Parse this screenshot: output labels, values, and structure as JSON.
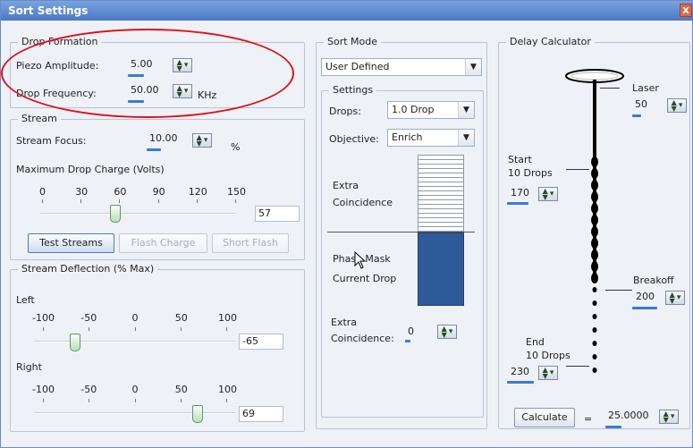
{
  "window": {
    "title": "Sort Settings",
    "close_label": "X"
  },
  "drop_formation": {
    "legend": "Drop Formation",
    "piezo_label": "Piezo Amplitude:",
    "piezo_value": "5.00",
    "freq_label": "Drop Frequency:",
    "freq_value": "50.00",
    "freq_unit": "KHz"
  },
  "stream": {
    "legend": "Stream",
    "focus_label": "Stream Focus:",
    "focus_value": "10.00",
    "focus_unit": "%",
    "charge_label": "Maximum Drop Charge (Volts)",
    "ticks": [
      "0",
      "30",
      "60",
      "90",
      "120",
      "150"
    ],
    "charge_slider_value": 57,
    "charge_value": "57",
    "test_button": "Test Streams",
    "flash_button": "Flash Charge",
    "short_button": "Short Flash"
  },
  "deflection": {
    "legend": "Stream Deflection (% Max)",
    "left_label": "Left",
    "left_ticks": [
      "-100",
      "-50",
      "0",
      "50",
      "100"
    ],
    "left_slider_value": -65,
    "left_value": "-65",
    "right_label": "Right",
    "right_ticks": [
      "-100",
      "-50",
      "0",
      "50",
      "100"
    ],
    "right_slider_value": 69,
    "right_value": "69"
  },
  "sort_mode": {
    "legend": "Sort Mode",
    "mode_value": "User Defined",
    "settings_legend": "Settings",
    "drops_label": "Drops:",
    "drops_value": "1.0 Drop",
    "objective_label": "Objective:",
    "objective_value": "Enrich",
    "extra_coinc_top": "Extra\nCoincidence",
    "phase_mask": "Phase Mask",
    "current_drop": "Current Drop",
    "extra_coinc_bottom_label": "Extra\nCoincidence:",
    "extra_coinc_bottom_value": "0"
  },
  "delay": {
    "legend": "Delay Calculator",
    "laser_label": "Laser",
    "laser_value": "50",
    "start_label": "Start\n10 Drops",
    "start_value": "170",
    "breakoff_label": "Breakoff",
    "breakoff_value": "200",
    "end_label": "End\n10 Drops",
    "end_value": "230",
    "calculate_button": "Calculate",
    "equals": "=",
    "result_value": "25.0000"
  },
  "colors": {
    "title_bar": "#4b78c6",
    "accent": "#3a7bd5",
    "annotation": "#e01020",
    "blue_box": "#2f5a9a"
  }
}
